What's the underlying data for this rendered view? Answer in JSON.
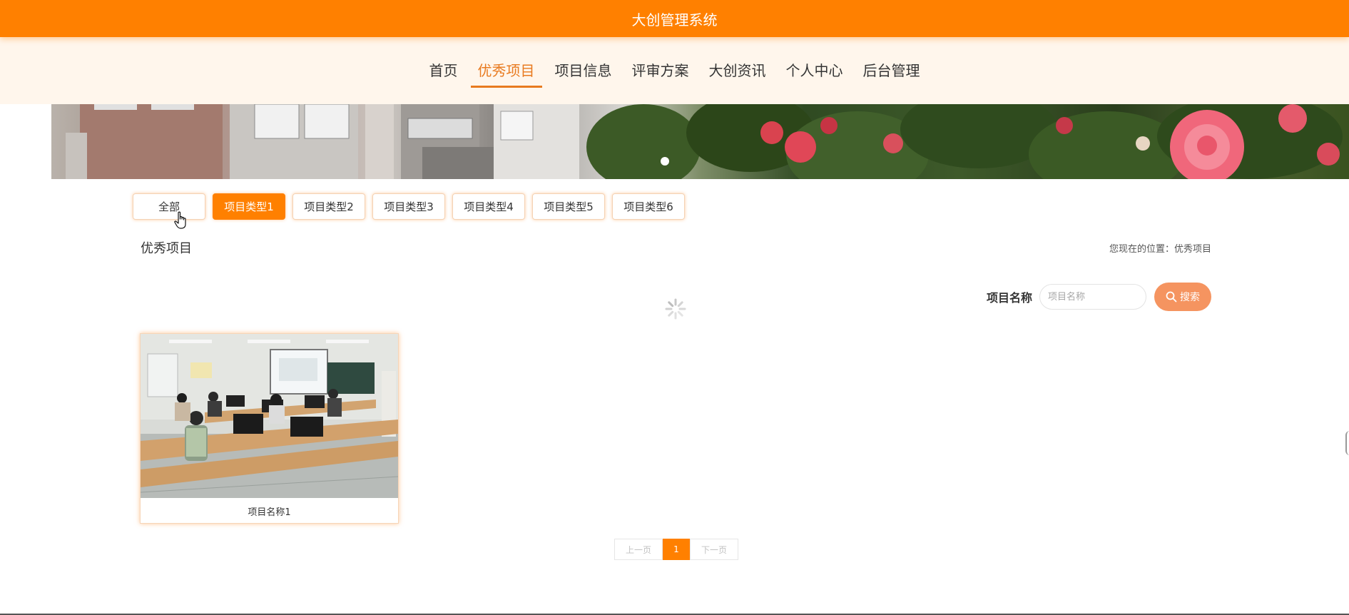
{
  "app": {
    "title": "大创管理系统"
  },
  "nav": {
    "items": [
      {
        "label": "首页",
        "active": false
      },
      {
        "label": "优秀项目",
        "active": true
      },
      {
        "label": "项目信息",
        "active": false
      },
      {
        "label": "评审方案",
        "active": false
      },
      {
        "label": "大创资讯",
        "active": false
      },
      {
        "label": "个人中心",
        "active": false
      },
      {
        "label": "后台管理",
        "active": false
      }
    ]
  },
  "filters": {
    "items": [
      {
        "label": "全部",
        "active": false
      },
      {
        "label": "项目类型1",
        "active": true
      },
      {
        "label": "项目类型2",
        "active": false
      },
      {
        "label": "项目类型3",
        "active": false
      },
      {
        "label": "项目类型4",
        "active": false
      },
      {
        "label": "项目类型5",
        "active": false
      },
      {
        "label": "项目类型6",
        "active": false
      }
    ]
  },
  "section": {
    "title": "优秀项目",
    "breadcrumb": "您现在的位置：优秀项目"
  },
  "search": {
    "label": "项目名称",
    "placeholder": "项目名称",
    "value": "",
    "button_label": "搜索"
  },
  "cards": [
    {
      "title": "项目名称1"
    }
  ],
  "pagination": {
    "prev_label": "上一页",
    "current_page": "1",
    "next_label": "下一页"
  },
  "colors": {
    "accent": "#ff8000",
    "nav_active": "#e87a1f",
    "nav_bg": "#fff6ec",
    "search_button": "#f59460"
  },
  "icons": {
    "search": "search-icon",
    "cursor": "hand-pointer-icon",
    "loading": "loading-spinner-icon"
  }
}
